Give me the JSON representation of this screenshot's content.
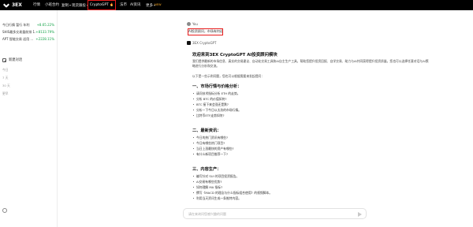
{
  "nav": {
    "logo_text": "3EX",
    "items": [
      {
        "label": "行情",
        "caret": ""
      },
      {
        "label": "小班合约",
        "caret": ""
      },
      {
        "label": "复制",
        "caret": "▾"
      },
      {
        "label": "现货跟投",
        "caret": "▾"
      }
    ],
    "active": {
      "label": "CryptoGPT",
      "badge": "🔥"
    },
    "right_items": [
      {
        "label": "法币",
        "caret": ""
      },
      {
        "label": "AI资讯",
        "caret": ""
      },
      {
        "label": "更多",
        "caret": "▾"
      }
    ],
    "right_badge": "NEW"
  },
  "sidebar": {
    "tickers": [
      {
        "name": "今日行情 暂行 年利",
        "change": "+8.65.22%"
      },
      {
        "name": "SHIS最多交易量前排 1.0",
        "change": "+8133.79%"
      },
      {
        "name": "APT 智能交易 适用 ...",
        "change": "+2228.11%"
      }
    ],
    "new_chat": "新建对话",
    "sections": [
      "今日",
      "7 天",
      "30 天",
      "更早"
    ]
  },
  "chat": {
    "user_label": "You",
    "user_message": "AI投资顾问，市场有何近况",
    "bot_label": "3EX CryptoGPT",
    "welcome_title": "欢迎来到3EX CryptoGPT AI投资顾问模块",
    "intro": "我们提供最新的市场信息、真实的交易建议、自动化交易工具和AI自主生产工具，帮助您提升投资回报、自学交易、助力与AI共同获得提升投资质量。您也可以选择任意对话与AI策略进行分析和交流。",
    "subtitle": "以下是一些示例问题，您也可以根据需要来发起提问：",
    "sections": [
      {
        "heading": "一、市场行情与价格分析：",
        "items": [
          "请问技术指标分析 ETH 的走势。",
          "分析 BTC 的价值如何?",
          "BTC 接下来会涨还是跌?",
          "分析一下今日以太坊的市场行情。",
          "比特币ETF走势如何?"
        ]
      },
      {
        "heading": "二、最新资讯：",
        "items": [
          "今日的热门资讯有哪些?",
          "今日有哪些热门项目?",
          "当日上涨最快的资产有哪些?",
          "有什么新项目推荐一下?"
        ]
      },
      {
        "heading": "三、内容生产：",
        "items": [
          "编写针对 SUI 的项目投资报告。",
          "AI交易有哪些优势?",
          "如何理解 MA 指标?",
          "撰写《MACD 的理念与什么指标组合使用》的视频脚本。",
          "利用当天资讯生成一条推特内容。"
        ]
      }
    ]
  },
  "input": {
    "placeholder": "请在来询问您感兴趣的问题",
    "value": ""
  }
}
